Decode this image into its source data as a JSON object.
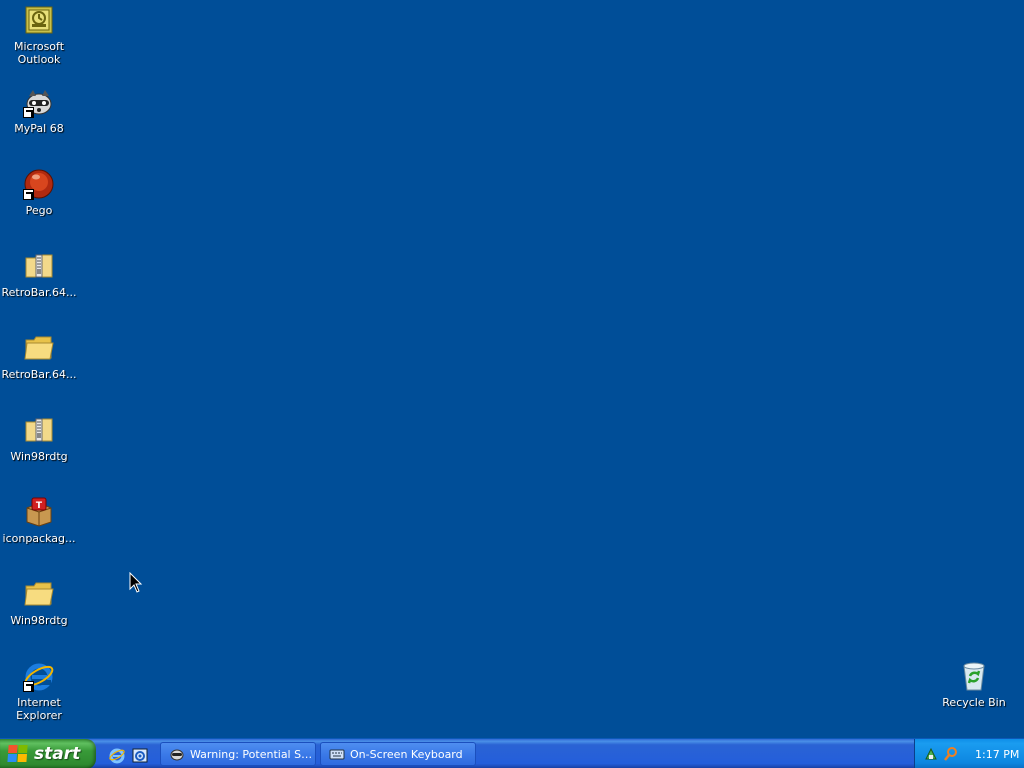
{
  "desktop": {
    "background_color": "#004e98",
    "icons": [
      {
        "label": "Microsoft\nOutlook",
        "icon": "outlook-icon"
      },
      {
        "label": "MyPal 68",
        "icon": "raccoon-icon"
      },
      {
        "label": "Pego",
        "icon": "pego-icon"
      },
      {
        "label": "RetroBar.64...",
        "icon": "zip-folder-icon"
      },
      {
        "label": "RetroBar.64...",
        "icon": "folder-icon"
      },
      {
        "label": "Win98rdtg",
        "icon": "zip-folder-icon"
      },
      {
        "label": "iconpackag...",
        "icon": "package-icon"
      },
      {
        "label": "Win98rdtg",
        "icon": "folder-icon"
      },
      {
        "label": "Internet\nExplorer",
        "icon": "ie-icon"
      },
      {
        "label": "Recycle Bin",
        "icon": "recycle-bin-icon"
      }
    ]
  },
  "taskbar": {
    "start_label": "start",
    "quick_launch": [
      {
        "icon": "ie-icon"
      },
      {
        "icon": "email-icon"
      }
    ],
    "tasks": [
      {
        "label": "Warning: Potential Se...",
        "icon": "raccoon-icon"
      },
      {
        "label": "On-Screen Keyboard",
        "icon": "keyboard-icon"
      }
    ],
    "tray": {
      "icons": [
        "network-icon",
        "search-icon"
      ],
      "clock": "1:17 PM"
    }
  }
}
